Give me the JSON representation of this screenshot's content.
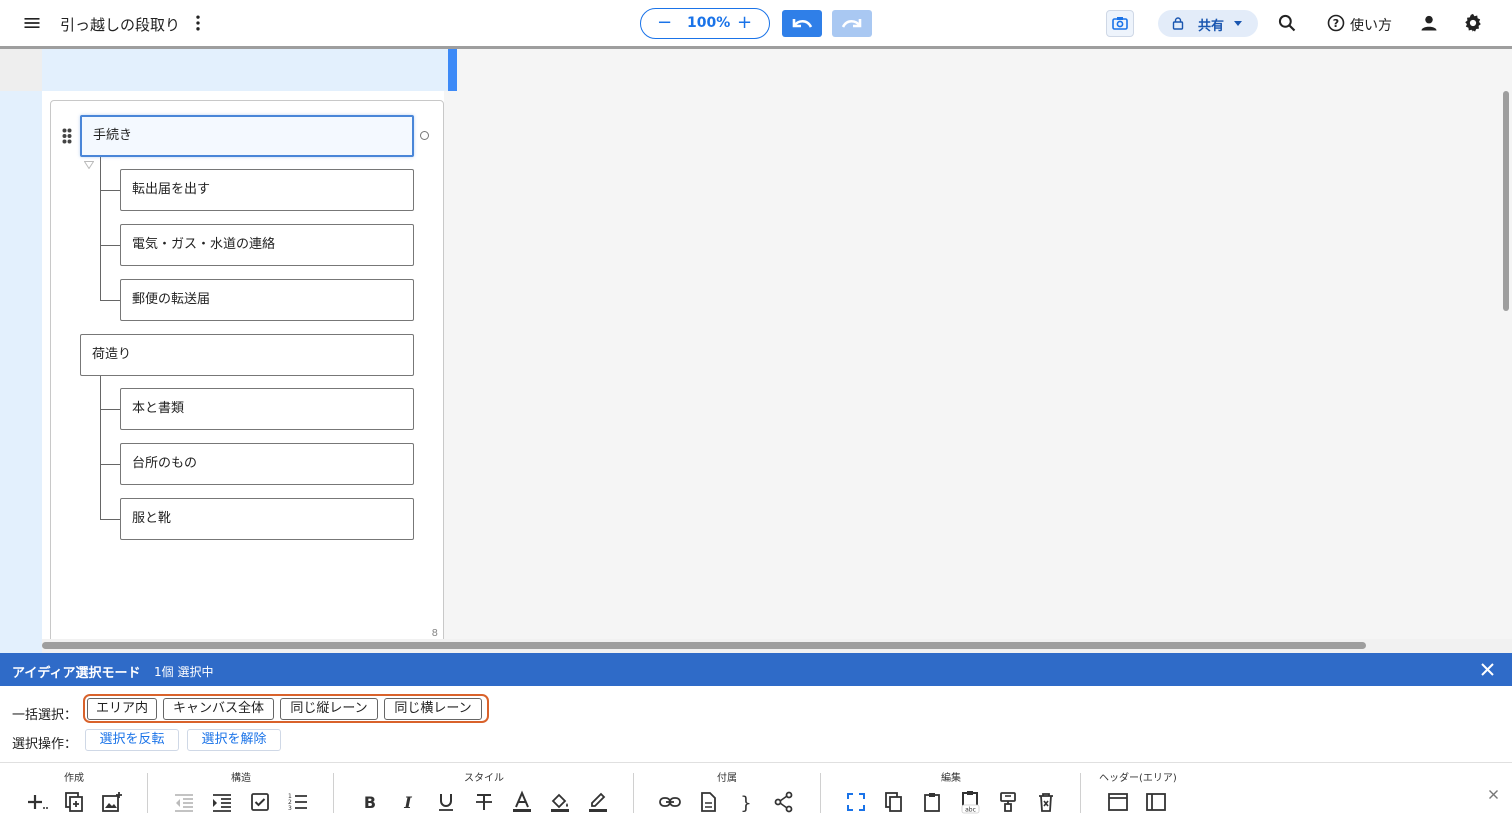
{
  "header": {
    "title": "引っ越しの段取り",
    "zoom": "100%",
    "share_label": "共有",
    "help_label": "使い方"
  },
  "canvas": {
    "nodes": [
      {
        "label": "手続き"
      },
      {
        "label": "転出届を出す"
      },
      {
        "label": "電気・ガス・水道の連絡"
      },
      {
        "label": "郵便の転送届"
      },
      {
        "label": "荷造り"
      },
      {
        "label": "本と書類"
      },
      {
        "label": "台所のもの"
      },
      {
        "label": "服と靴"
      }
    ],
    "area_count": "8"
  },
  "modebar": {
    "title": "アイディア選択モード",
    "count": "1個 選択中"
  },
  "selection": {
    "bulk_label": "一括選択：",
    "bulk_buttons": [
      "エリア内",
      "キャンバス全体",
      "同じ縦レーン",
      "同じ横レーン"
    ],
    "ops_label": "選択操作：",
    "ops_buttons": [
      "選択を反転",
      "選択を解除"
    ]
  },
  "toolbar": {
    "groups": [
      "作成",
      "構造",
      "スタイル",
      "付属",
      "編集",
      "ヘッダー(エリア)"
    ]
  },
  "colors": {
    "accent": "#1a73e8",
    "modebar": "#2f6bc8",
    "highlight": "#d9622b",
    "lane": "#e3f0fd"
  }
}
